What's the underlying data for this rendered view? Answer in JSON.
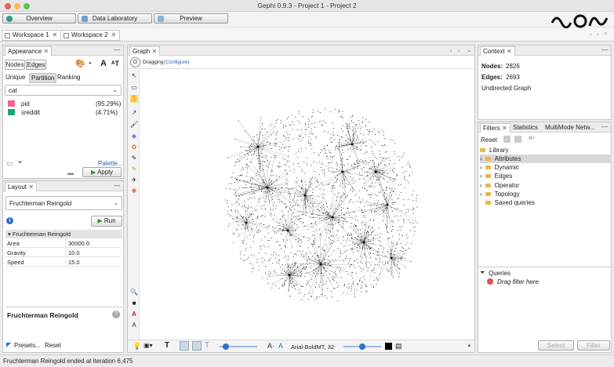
{
  "window": {
    "title": "Gephi 0.9.3 - Project 1 - Project 2"
  },
  "nav": {
    "overview": "Overview",
    "data_lab": "Data Laboratory",
    "preview": "Preview"
  },
  "workspaces": [
    {
      "label": "Workspace 1"
    },
    {
      "label": "Workspace 2"
    }
  ],
  "appearance": {
    "tab": "Appearance",
    "nodes_label": "Nodes",
    "edges_label": "Edges",
    "modes": [
      "Unique",
      "Partition",
      "Ranking"
    ],
    "attribute": "cat",
    "partitions": [
      {
        "name": "pid",
        "pct": "(95.29%)",
        "color": "#f06292"
      },
      {
        "name": "sreddit",
        "pct": "(4.71%)",
        "color": "#1fa37a"
      }
    ],
    "palette_link": "Palette...",
    "apply_label": "Apply"
  },
  "layout": {
    "tab": "Layout",
    "algorithm": "Fruchterman Reingold",
    "run_label": "Run",
    "section": "Fruchterman Reingold",
    "params": [
      {
        "key": "Area",
        "value": "30000.0"
      },
      {
        "key": "Gravity",
        "value": "10.0"
      },
      {
        "key": "Speed",
        "value": "15.0"
      }
    ],
    "desc_title": "Fruchterman Reingold",
    "presets_label": "Presets...",
    "reset_label": "Reset"
  },
  "graph": {
    "tab": "Graph",
    "mode": "Dragging",
    "configure": "(Configure)",
    "font_label": "Arial-BoldMT, 32"
  },
  "context": {
    "tab": "Context",
    "nodes_label": "Nodes:",
    "nodes_value": "2826",
    "edges_label": "Edges:",
    "edges_value": "2693",
    "graph_type": "Undirected Graph"
  },
  "filters": {
    "tabs": [
      "Filters",
      "Statistics",
      "MultiMode Netw..."
    ],
    "reset_label": "Reset",
    "library_label": "Library",
    "items": [
      "Attributes",
      "Dynamic",
      "Edges",
      "Operator",
      "Topology",
      "Saved queries"
    ],
    "queries_label": "Queries",
    "drag_hint": "Drag filter here",
    "select_label": "Select",
    "filter_label": "Filter"
  },
  "status": {
    "text": "Fruchterman Reingold ended at iteration 6,475"
  }
}
